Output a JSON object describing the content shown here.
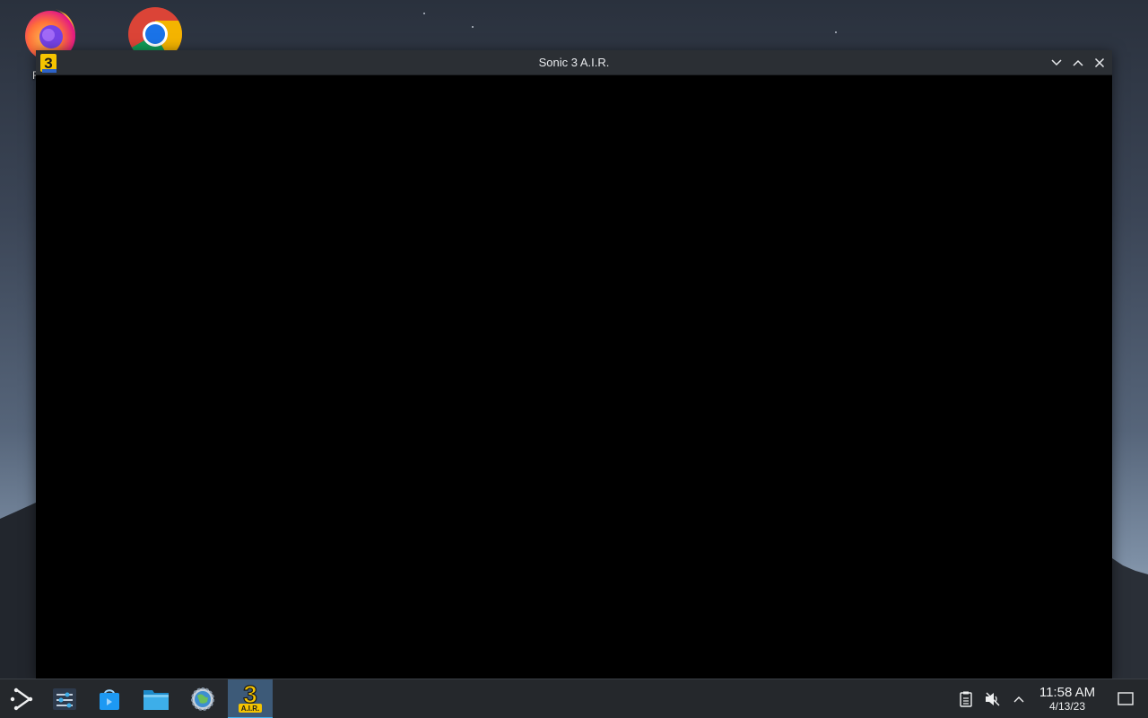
{
  "desktop": {
    "icons": [
      {
        "name": "Firefox",
        "label": "F"
      },
      {
        "name": "Google Chrome"
      }
    ]
  },
  "window": {
    "title": "Sonic 3 A.I.R.",
    "app_icon_text": "3",
    "controls": [
      "minimize",
      "maximize",
      "close"
    ]
  },
  "taskbar": {
    "items": [
      {
        "icon": "launcher-icon"
      },
      {
        "icon": "settings-sliders-icon"
      },
      {
        "icon": "discover-store-icon"
      },
      {
        "icon": "folder-icon"
      },
      {
        "icon": "globe-settings-icon"
      },
      {
        "icon": "sonic3air-icon",
        "text_main": "3",
        "text_sub": "A.I.R.",
        "active": true
      }
    ],
    "tray": {
      "icons": [
        "clipboard-icon",
        "volume-muted-icon",
        "chevron-up-icon"
      ],
      "time": "11:58 AM",
      "date": "4/13/23"
    }
  },
  "colors": {
    "accent": "#3daee9",
    "taskbar_bg": "#25282c",
    "titlebar_bg": "#2b2f34"
  }
}
